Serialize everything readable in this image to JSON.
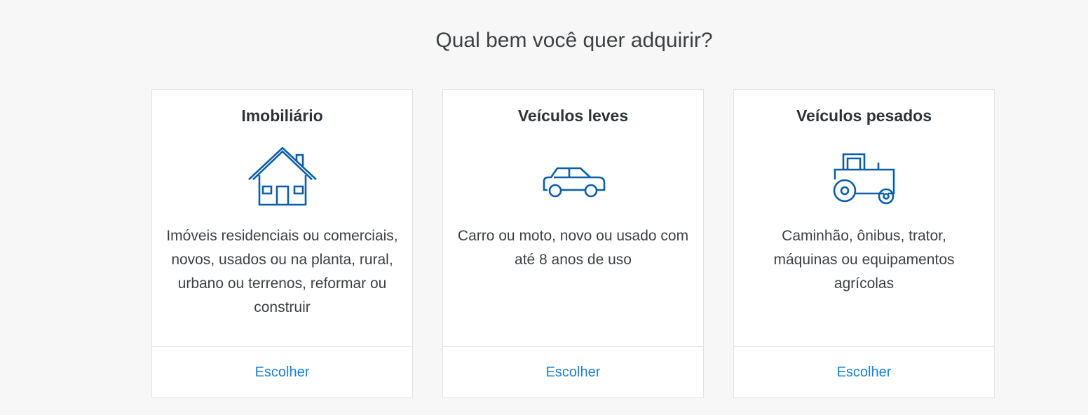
{
  "page": {
    "title": "Qual bem você quer adquirir?"
  },
  "colors": {
    "accent": "#1a7fd6",
    "icon_stroke": "#0a5fa8",
    "text": "#3d4144",
    "background": "#f7f7f7"
  },
  "cards": [
    {
      "title": "Imobiliário",
      "icon": "house-icon",
      "description": "Imóveis residenciais ou comerciais, novos, usados ou na planta, rural, urbano ou terrenos, reformar ou construir",
      "action_label": "Escolher"
    },
    {
      "title": "Veículos leves",
      "icon": "car-icon",
      "description": "Carro ou moto, novo ou usado com até 8 anos de uso",
      "action_label": "Escolher"
    },
    {
      "title": "Veículos pesados",
      "icon": "tractor-icon",
      "description": "Caminhão, ônibus, trator, máquinas ou equipamentos agrícolas",
      "action_label": "Escolher"
    }
  ]
}
